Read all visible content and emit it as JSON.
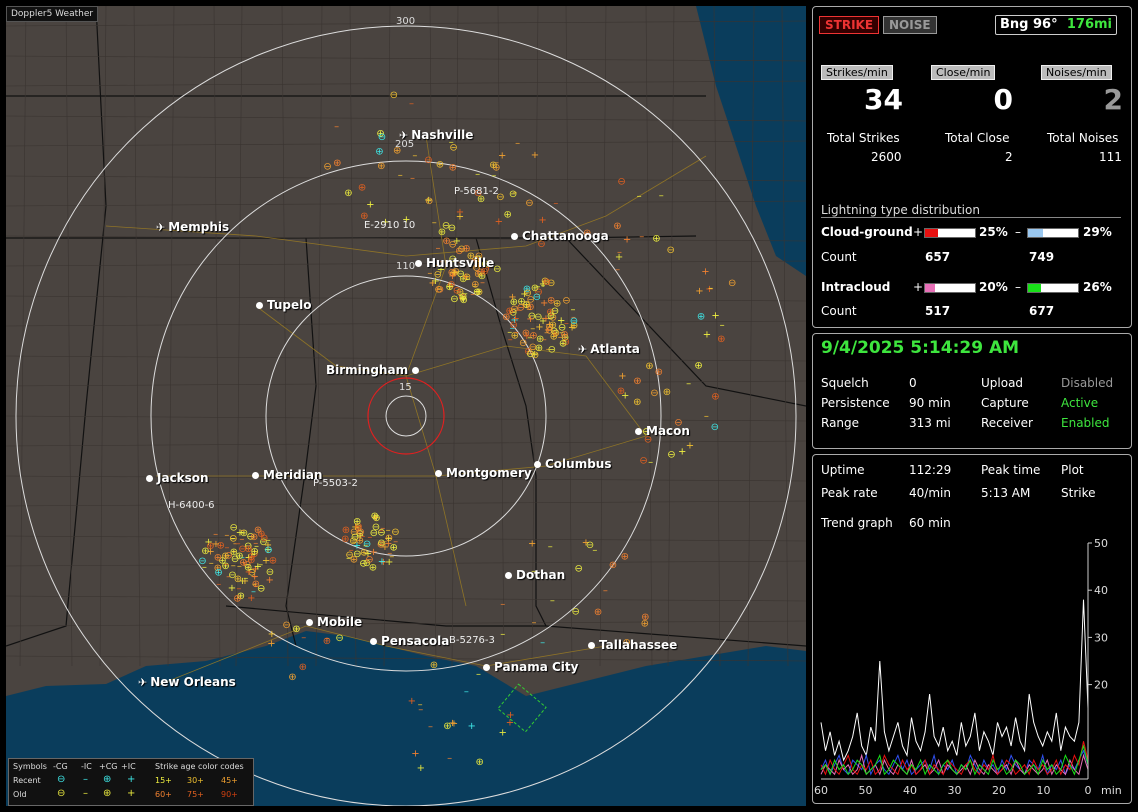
{
  "map": {
    "title": "Doppler5 Weather",
    "ring_labels": {
      "r300": "300",
      "r205": "205",
      "r110": "110",
      "r15": "15"
    },
    "cities": [
      {
        "name": "Nashville",
        "kind": "airport"
      },
      {
        "name": "Memphis",
        "kind": "airport"
      },
      {
        "name": "Chattanooga",
        "kind": "city"
      },
      {
        "name": "Huntsville",
        "kind": "city"
      },
      {
        "name": "Tupelo",
        "kind": "city"
      },
      {
        "name": "Atlanta",
        "kind": "airport"
      },
      {
        "name": "Birmingham",
        "kind": "city"
      },
      {
        "name": "Macon",
        "kind": "city"
      },
      {
        "name": "Jackson",
        "kind": "city"
      },
      {
        "name": "Meridian",
        "kind": "city"
      },
      {
        "name": "Montgomery",
        "kind": "city"
      },
      {
        "name": "Columbus",
        "kind": "city"
      },
      {
        "name": "Dothan",
        "kind": "city"
      },
      {
        "name": "Mobile",
        "kind": "city"
      },
      {
        "name": "Pensacola",
        "kind": "city"
      },
      {
        "name": "Tallahassee",
        "kind": "city"
      },
      {
        "name": "Panama City",
        "kind": "city"
      },
      {
        "name": "New Orleans",
        "kind": "airport"
      }
    ],
    "sensors": [
      "P-5681-2",
      "E-2910 10",
      "P-5503-2",
      "H-6400-6",
      "B-5276-3"
    ],
    "legend": {
      "symbols_label": "Symbols",
      "cols": [
        "-CG",
        "-IC",
        "+CG",
        "+IC"
      ],
      "age_title": "Strike age color codes",
      "recent_label": "Recent",
      "old_label": "Old",
      "recent_ages": [
        "15+",
        "30+",
        "45+"
      ],
      "old_ages": [
        "60+",
        "75+",
        "90+"
      ]
    }
  },
  "top": {
    "strike_btn": "STRIKE",
    "noise_btn": "NOISE",
    "bearing": "Bng 96°",
    "distance": "176mi",
    "strikes_min_label": "Strikes/min",
    "close_min_label": "Close/min",
    "noises_min_label": "Noises/min",
    "strikes_min": "34",
    "close_min": "0",
    "noises_min": "2",
    "total_strikes_label": "Total Strikes",
    "total_close_label": "Total Close",
    "total_noises_label": "Total Noises",
    "total_strikes": "2600",
    "total_close": "2",
    "total_noises": "111",
    "dist_title": "Lightning type distribution",
    "cloud_ground_label": "Cloud-ground",
    "intracloud_label": "Intracloud",
    "count_label": "Count",
    "plus": "+",
    "minus": "–",
    "cg_plus_pct": "25%",
    "cg_minus_pct": "29%",
    "cg_plus_count": "657",
    "cg_minus_count": "749",
    "ic_plus_pct": "20%",
    "ic_minus_pct": "26%",
    "ic_plus_count": "517",
    "ic_minus_count": "677"
  },
  "bar_fill": {
    "cg_plus": 0.25,
    "cg_minus": 0.29,
    "ic_plus": 0.2,
    "ic_minus": 0.26
  },
  "colors": {
    "cg_plus": "#e81010",
    "cg_minus": "#9ac8f0",
    "ic_plus": "#e870b8",
    "ic_minus": "#18e018",
    "accent_green": "#3ee63e"
  },
  "status": {
    "datetime": "9/4/2025 5:14:29 AM",
    "squelch_label": "Squelch",
    "squelch": "0",
    "persistence_label": "Persistence",
    "persistence": "90 min",
    "range_label": "Range",
    "range": "313 mi",
    "upload_label": "Upload",
    "upload": "Disabled",
    "capture_label": "Capture",
    "capture": "Active",
    "receiver_label": "Receiver",
    "receiver": "Enabled"
  },
  "trend": {
    "uptime_label": "Uptime",
    "uptime": "112:29",
    "peak_time_label": "Peak time",
    "peak_time": "5:13 AM",
    "plot_label": "Plot",
    "peak_rate_label": "Peak rate",
    "peak_rate": "40/min",
    "plot_value": "Strike",
    "trend_graph_label": "Trend graph",
    "trend_graph": "60 min",
    "y_ticks": [
      "50",
      "40",
      "30",
      "20"
    ],
    "x_ticks": [
      "60",
      "50",
      "40",
      "30",
      "20",
      "10",
      "0"
    ],
    "x_unit": "min"
  },
  "chart_data": {
    "type": "line",
    "xlabel": "min",
    "xlim": [
      60,
      0
    ],
    "ylim": [
      0,
      50
    ],
    "series": [
      {
        "values": [
          12,
          6,
          10,
          5,
          8,
          4,
          6,
          9,
          14,
          7,
          5,
          11,
          8,
          25,
          10,
          6,
          9,
          12,
          7,
          5,
          13,
          8,
          6,
          10,
          18,
          9,
          7,
          11,
          6,
          8,
          5,
          12,
          7,
          9,
          14,
          6,
          10,
          8,
          5,
          12,
          9,
          11,
          7,
          13,
          8,
          6,
          18,
          12,
          9,
          7,
          10,
          8,
          14,
          6,
          11,
          9,
          8,
          12,
          38,
          15
        ]
      },
      {
        "values": [
          2,
          4,
          1,
          3,
          5,
          2,
          1,
          4,
          3,
          2,
          5,
          1,
          3,
          4,
          2,
          1,
          3,
          5,
          2,
          4,
          1,
          2,
          3,
          4,
          2,
          5,
          1,
          3,
          2,
          4,
          1,
          3,
          2,
          5,
          3,
          1,
          4,
          2,
          3,
          1,
          4,
          2,
          5,
          3,
          2,
          1,
          4,
          3,
          2,
          5,
          1,
          3,
          2,
          4,
          1,
          3,
          2,
          4,
          6,
          3
        ]
      },
      {
        "values": [
          1,
          3,
          2,
          1,
          4,
          2,
          3,
          1,
          2,
          5,
          1,
          2,
          3,
          1,
          4,
          2,
          1,
          3,
          2,
          1,
          4,
          1,
          2,
          3,
          1,
          2,
          4,
          1,
          3,
          2,
          1,
          2,
          3,
          1,
          4,
          2,
          1,
          3,
          2,
          1,
          2,
          3,
          1,
          4,
          2,
          1,
          3,
          2,
          1,
          2,
          4,
          1,
          3,
          2,
          1,
          4,
          2,
          1,
          5,
          2
        ]
      },
      {
        "values": [
          3,
          1,
          4,
          2,
          1,
          3,
          5,
          2,
          1,
          3,
          2,
          4,
          1,
          2,
          5,
          3,
          2,
          1,
          4,
          2,
          3,
          1,
          2,
          4,
          1,
          3,
          2,
          1,
          4,
          3,
          2,
          1,
          3,
          4,
          2,
          1,
          3,
          2,
          5,
          1,
          2,
          4,
          3,
          1,
          2,
          3,
          1,
          4,
          2,
          3,
          1,
          2,
          4,
          1,
          3,
          2,
          5,
          3,
          8,
          4
        ]
      },
      {
        "values": [
          2,
          3,
          1,
          4,
          2,
          3,
          1,
          2,
          4,
          3,
          1,
          2,
          3,
          5,
          1,
          2,
          4,
          3,
          2,
          1,
          3,
          2,
          4,
          1,
          3,
          2,
          1,
          3,
          4,
          2,
          1,
          3,
          2,
          4,
          1,
          3,
          2,
          1,
          4,
          2,
          3,
          1,
          2,
          4,
          3,
          1,
          2,
          3,
          1,
          4,
          2,
          3,
          1,
          2,
          5,
          3,
          1,
          4,
          7,
          3
        ]
      }
    ]
  }
}
